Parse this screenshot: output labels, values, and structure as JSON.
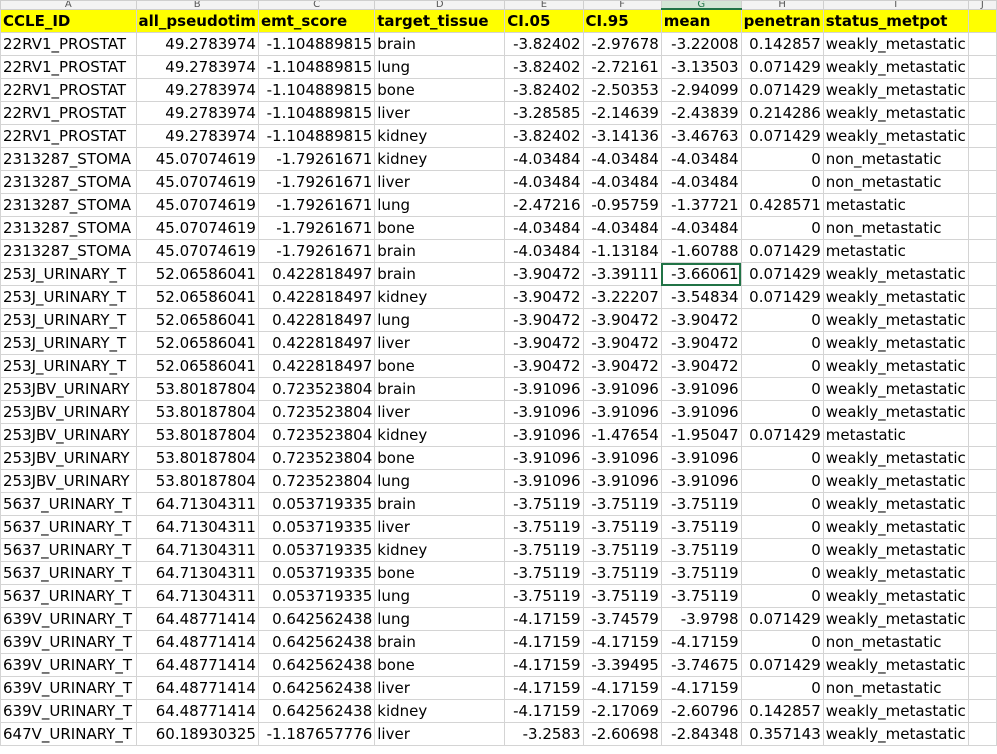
{
  "column_letters": [
    "A",
    "B",
    "C",
    "D",
    "E",
    "F",
    "G",
    "H",
    "I",
    "J"
  ],
  "active_column": "G",
  "selected_cell": {
    "row": 10,
    "col": 6
  },
  "headers": [
    "CCLE_ID",
    "all_pseudotim",
    "emt_score",
    "target_tissue",
    "CI.05",
    "CI.95",
    "mean",
    "penetran",
    "status_metpot",
    ""
  ],
  "rows": [
    [
      "22RV1_PROSTAT",
      "49.2783974",
      "-1.104889815",
      "brain",
      "-3.82402",
      "-2.97678",
      "-3.22008",
      "0.142857",
      "weakly_metastatic"
    ],
    [
      "22RV1_PROSTAT",
      "49.2783974",
      "-1.104889815",
      "lung",
      "-3.82402",
      "-2.72161",
      "-3.13503",
      "0.071429",
      "weakly_metastatic"
    ],
    [
      "22RV1_PROSTAT",
      "49.2783974",
      "-1.104889815",
      "bone",
      "-3.82402",
      "-2.50353",
      "-2.94099",
      "0.071429",
      "weakly_metastatic"
    ],
    [
      "22RV1_PROSTAT",
      "49.2783974",
      "-1.104889815",
      "liver",
      "-3.28585",
      "-2.14639",
      "-2.43839",
      "0.214286",
      "weakly_metastatic"
    ],
    [
      "22RV1_PROSTAT",
      "49.2783974",
      "-1.104889815",
      "kidney",
      "-3.82402",
      "-3.14136",
      "-3.46763",
      "0.071429",
      "weakly_metastatic"
    ],
    [
      "2313287_STOMA",
      "45.07074619",
      "-1.79261671",
      "kidney",
      "-4.03484",
      "-4.03484",
      "-4.03484",
      "0",
      "non_metastatic"
    ],
    [
      "2313287_STOMA",
      "45.07074619",
      "-1.79261671",
      "liver",
      "-4.03484",
      "-4.03484",
      "-4.03484",
      "0",
      "non_metastatic"
    ],
    [
      "2313287_STOMA",
      "45.07074619",
      "-1.79261671",
      "lung",
      "-2.47216",
      "-0.95759",
      "-1.37721",
      "0.428571",
      "metastatic"
    ],
    [
      "2313287_STOMA",
      "45.07074619",
      "-1.79261671",
      "bone",
      "-4.03484",
      "-4.03484",
      "-4.03484",
      "0",
      "non_metastatic"
    ],
    [
      "2313287_STOMA",
      "45.07074619",
      "-1.79261671",
      "brain",
      "-4.03484",
      "-1.13184",
      "-1.60788",
      "0.071429",
      "metastatic"
    ],
    [
      "253J_URINARY_T",
      "52.06586041",
      "0.422818497",
      "brain",
      "-3.90472",
      "-3.39111",
      "-3.66061",
      "0.071429",
      "weakly_metastatic"
    ],
    [
      "253J_URINARY_T",
      "52.06586041",
      "0.422818497",
      "kidney",
      "-3.90472",
      "-3.22207",
      "-3.54834",
      "0.071429",
      "weakly_metastatic"
    ],
    [
      "253J_URINARY_T",
      "52.06586041",
      "0.422818497",
      "lung",
      "-3.90472",
      "-3.90472",
      "-3.90472",
      "0",
      "weakly_metastatic"
    ],
    [
      "253J_URINARY_T",
      "52.06586041",
      "0.422818497",
      "liver",
      "-3.90472",
      "-3.90472",
      "-3.90472",
      "0",
      "weakly_metastatic"
    ],
    [
      "253J_URINARY_T",
      "52.06586041",
      "0.422818497",
      "bone",
      "-3.90472",
      "-3.90472",
      "-3.90472",
      "0",
      "weakly_metastatic"
    ],
    [
      "253JBV_URINARY",
      "53.80187804",
      "0.723523804",
      "brain",
      "-3.91096",
      "-3.91096",
      "-3.91096",
      "0",
      "weakly_metastatic"
    ],
    [
      "253JBV_URINARY",
      "53.80187804",
      "0.723523804",
      "liver",
      "-3.91096",
      "-3.91096",
      "-3.91096",
      "0",
      "weakly_metastatic"
    ],
    [
      "253JBV_URINARY",
      "53.80187804",
      "0.723523804",
      "kidney",
      "-3.91096",
      "-1.47654",
      "-1.95047",
      "0.071429",
      "metastatic"
    ],
    [
      "253JBV_URINARY",
      "53.80187804",
      "0.723523804",
      "bone",
      "-3.91096",
      "-3.91096",
      "-3.91096",
      "0",
      "weakly_metastatic"
    ],
    [
      "253JBV_URINARY",
      "53.80187804",
      "0.723523804",
      "lung",
      "-3.91096",
      "-3.91096",
      "-3.91096",
      "0",
      "weakly_metastatic"
    ],
    [
      "5637_URINARY_T",
      "64.71304311",
      "0.053719335",
      "brain",
      "-3.75119",
      "-3.75119",
      "-3.75119",
      "0",
      "weakly_metastatic"
    ],
    [
      "5637_URINARY_T",
      "64.71304311",
      "0.053719335",
      "liver",
      "-3.75119",
      "-3.75119",
      "-3.75119",
      "0",
      "weakly_metastatic"
    ],
    [
      "5637_URINARY_T",
      "64.71304311",
      "0.053719335",
      "kidney",
      "-3.75119",
      "-3.75119",
      "-3.75119",
      "0",
      "weakly_metastatic"
    ],
    [
      "5637_URINARY_T",
      "64.71304311",
      "0.053719335",
      "bone",
      "-3.75119",
      "-3.75119",
      "-3.75119",
      "0",
      "weakly_metastatic"
    ],
    [
      "5637_URINARY_T",
      "64.71304311",
      "0.053719335",
      "lung",
      "-3.75119",
      "-3.75119",
      "-3.75119",
      "0",
      "weakly_metastatic"
    ],
    [
      "639V_URINARY_T",
      "64.48771414",
      "0.642562438",
      "lung",
      "-4.17159",
      "-3.74579",
      "-3.9798",
      "0.071429",
      "weakly_metastatic"
    ],
    [
      "639V_URINARY_T",
      "64.48771414",
      "0.642562438",
      "brain",
      "-4.17159",
      "-4.17159",
      "-4.17159",
      "0",
      "non_metastatic"
    ],
    [
      "639V_URINARY_T",
      "64.48771414",
      "0.642562438",
      "bone",
      "-4.17159",
      "-3.39495",
      "-3.74675",
      "0.071429",
      "weakly_metastatic"
    ],
    [
      "639V_URINARY_T",
      "64.48771414",
      "0.642562438",
      "liver",
      "-4.17159",
      "-4.17159",
      "-4.17159",
      "0",
      "non_metastatic"
    ],
    [
      "639V_URINARY_T",
      "64.48771414",
      "0.642562438",
      "kidney",
      "-4.17159",
      "-2.17069",
      "-2.60796",
      "0.142857",
      "weakly_metastatic"
    ],
    [
      "647V_URINARY_T",
      "60.18930325",
      "-1.187657776",
      "liver",
      "-3.2583",
      "-2.60698",
      "-2.84348",
      "0.357143",
      "weakly_metastatic"
    ]
  ]
}
